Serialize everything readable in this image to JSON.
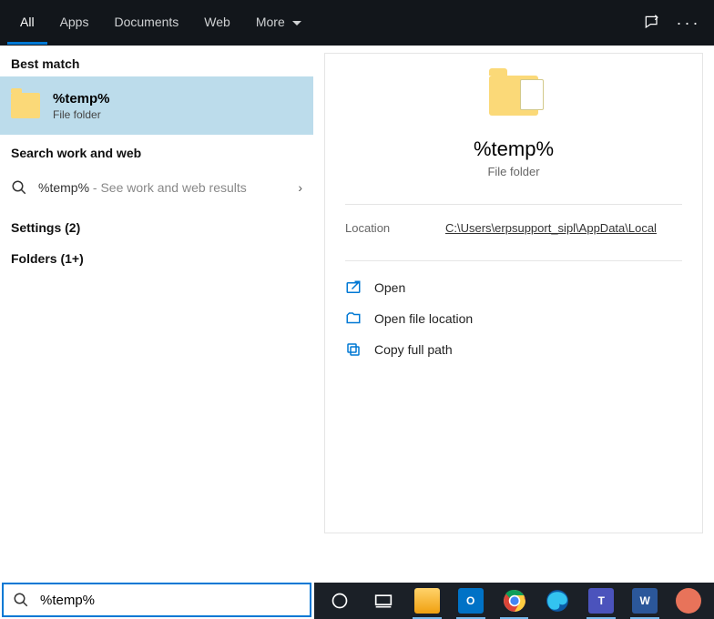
{
  "tabs": {
    "items": [
      "All",
      "Apps",
      "Documents",
      "Web",
      "More"
    ],
    "activeIndex": 0
  },
  "left": {
    "sections": {
      "best_match": "Best match",
      "search_web": "Search work and web",
      "settings": "Settings (2)",
      "folders": "Folders (1+)"
    },
    "bestMatch": {
      "title": "%temp%",
      "subtitle": "File folder"
    },
    "webRow": {
      "query": "%temp%",
      "hint": " - See work and web results"
    }
  },
  "preview": {
    "title": "%temp%",
    "subtitle": "File folder",
    "locationLabel": "Location",
    "locationPath": "C:\\Users\\erpsupport_sipl\\AppData\\Local",
    "actions": {
      "open": "Open",
      "openLocation": "Open file location",
      "copyPath": "Copy full path"
    }
  },
  "search": {
    "value": "%temp%"
  },
  "icons": {
    "feedback": "feedback-icon",
    "more": "more-icon"
  }
}
